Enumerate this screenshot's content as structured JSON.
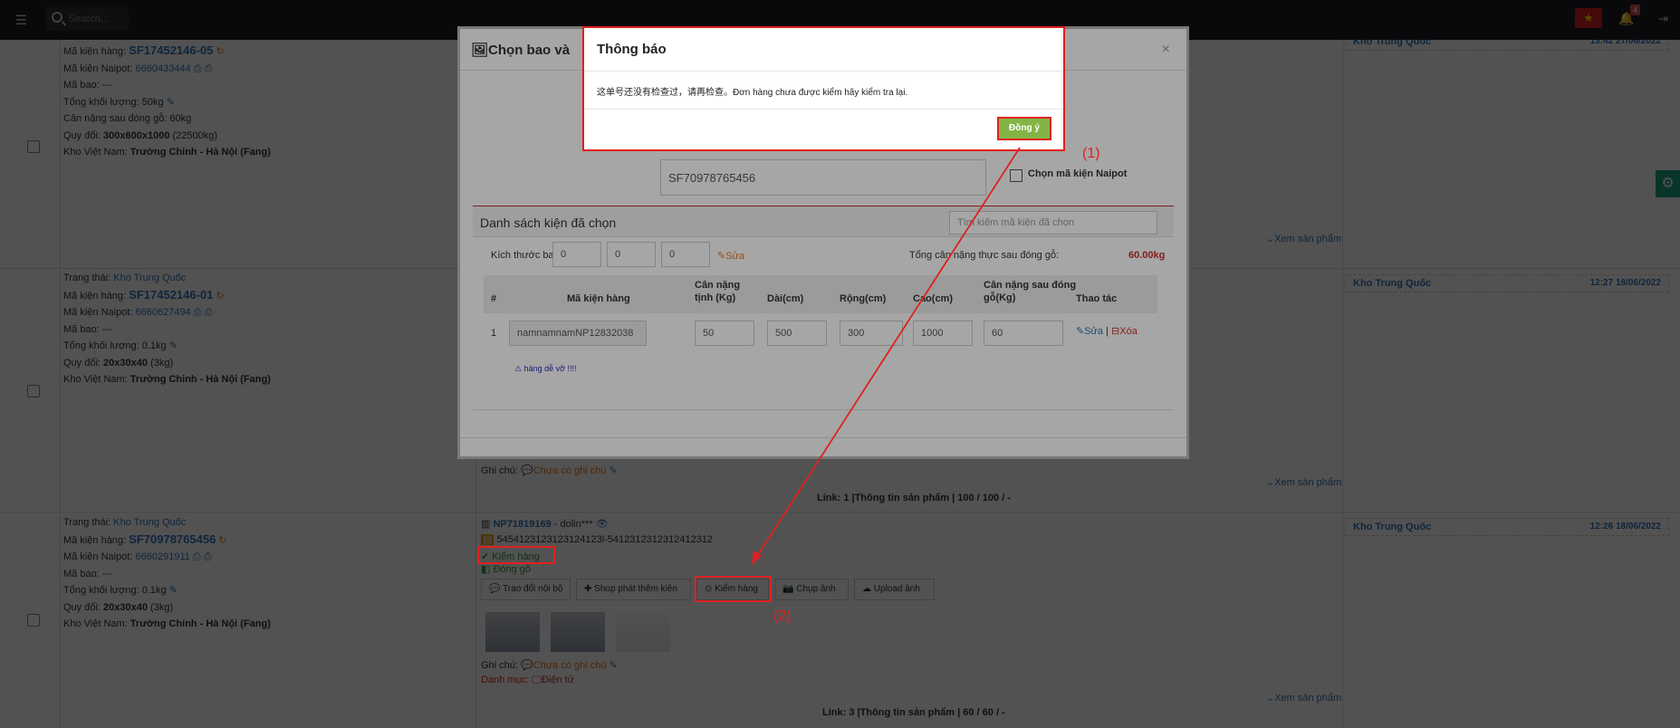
{
  "topbar": {
    "search_placeholder": "Search..."
  },
  "notifications": {
    "count": "4"
  },
  "rows": [
    {
      "status_label": "",
      "status_value": "",
      "code_label": "Mã kiện hàng:",
      "code": "SF17452146-05",
      "naipot_label": "Mã kiện Naipot:",
      "naipot": "6660433444",
      "bao": "Mã bao: ---",
      "weight": "Tổng khối lượng: 50kg",
      "after": "Cân nặng sau đóng gỗ: 60kg",
      "quydoi_label": "Quy đổi:",
      "quydoi": "300x600x1000",
      "quydoi_extra": "(22500kg)",
      "kho_label": "Kho Việt Nam:",
      "kho": "Trường Chinh - Hà Nội (Fang)"
    },
    {
      "status_label": "Trang thái:",
      "status_value": "Kho Trung Quốc",
      "code_label": "Mã kiện hàng:",
      "code": "SF17452146-01",
      "naipot_label": "Mã kiện Naipot:",
      "naipot": "6660627494",
      "bao": "Mã bao: ---",
      "weight": "Tổng khối lượng: 0.1kg",
      "quydoi_label": "Quy đổi:",
      "quydoi": "20x30x40",
      "quydoi_extra": "(3kg)",
      "kho_label": "Kho Việt Nam:",
      "kho": "Trường Chinh - Hà Nội (Fang)"
    },
    {
      "status_label": "Trang thái:",
      "status_value": "Kho Trung Quốc",
      "code_label": "Mã kiện hàng:",
      "code": "SF70978765456",
      "naipot_label": "Mã kiện Naipot:",
      "naipot": "6660291911",
      "bao": "Mã bao: ---",
      "weight": "Tổng khối lượng: 0.1kg",
      "quydoi_label": "Quy đổi:",
      "quydoi": "20x30x40",
      "quydoi_extra": "(3kg)",
      "kho_label": "Kho Việt Nam:",
      "kho": "Trường Chinh - Hà Nội (Fang)"
    }
  ],
  "right": {
    "r1": {
      "wh": "Kho Trung Quốc",
      "time": "13:42 27/06/2022"
    },
    "r2": {
      "wh": "Kho Trung Quốc",
      "time": "12:27 18/06/2022"
    },
    "r3": {
      "wh": "Kho Trung Quốc",
      "time": "12:26 18/06/2022"
    },
    "xem": "Xem sản phẩm"
  },
  "middle": {
    "note_label": "Ghi chú:",
    "note_value": "Chưa có ghi chú",
    "link2": "Link: 1 |Thông tin sản phẩm | 100 / 100 / -",
    "np": "NP71819169",
    "np_user": "- dolin***",
    "tracking": "5454123123123124123l-5412312312312412312",
    "kiem": "Kiểm hàng",
    "dong": "Đóng gỗ",
    "buttons": [
      "Trao đổi nội bộ",
      "Shop phát thêm kiện",
      "Kiểm hàng",
      "Chụp ảnh",
      "Upload ảnh"
    ],
    "danhmuc_label": "Danh mục:",
    "danhmuc": "Điện tử",
    "link3": "Link: 3 |Thông tin sản phẩm | 60 / 60 / -"
  },
  "modal1": {
    "title": "Chọn bao và",
    "input": "SF70978765456",
    "chk": "Chọn mã kiện Naipot",
    "list_title": "Danh sách kiện đã chọn",
    "list_search": "Tìm kiếm mã kiện đã chọn",
    "size_label": "Kích thước bao",
    "sizes": [
      "0",
      "0",
      "0"
    ],
    "edit": "Sửa",
    "total_label": "Tổng cân nặng thực sau đóng gỗ:",
    "total": "60.00kg",
    "cols": [
      "#",
      "Mã kiện hàng",
      "Cân nặng tịnh (Kg)",
      "Dài(cm)",
      "Rộng(cm)",
      "Cao(cm)",
      "Cân nặng sau đóng gỗ(Kg)",
      "Thao tác"
    ],
    "row": {
      "n": "1",
      "code": "namnamnamNP12832038",
      "w": "50",
      "d": "500",
      "r": "300",
      "c": "1000",
      "a": "60",
      "edit": "Sửa",
      "sep": "|",
      "del": "Xóa"
    },
    "warn": "hàng dễ vỡ !!!!"
  },
  "modal2": {
    "title": "Thông báo",
    "message": "这单号还没有检查过，请再检查。Đơn hàng chưa được kiểm hãy kiểm tra lại.",
    "ok": "Đồng ý"
  },
  "annotations": {
    "a1": "(1)",
    "a2": "(2)"
  },
  "colors": {
    "red": "#e02020",
    "green": "#83b546",
    "link": "#2f74b8",
    "orange": "#e8781e"
  }
}
